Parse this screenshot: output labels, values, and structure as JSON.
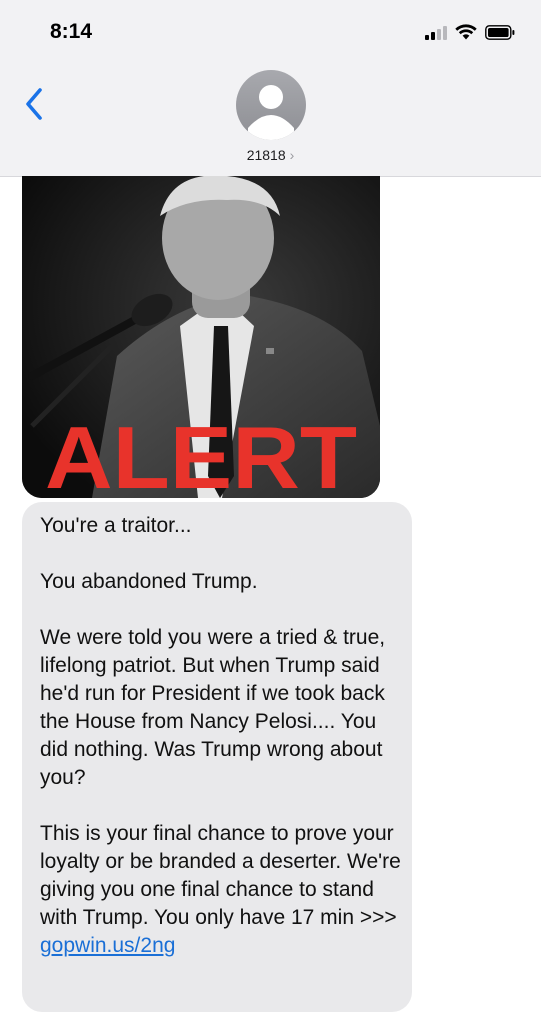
{
  "status_bar": {
    "time": "8:14"
  },
  "header": {
    "contact": "21818",
    "chevron": "›"
  },
  "message": {
    "image_text": "ALERT",
    "paragraphs": [
      "You're a traitor...",
      "You abandoned Trump.",
      "We were told you were a tried & true, lifelong patriot. But when Trump said he'd run for President if we took back the House from Nancy Pelosi.... You did nothing. Was Trump wrong about you?"
    ],
    "final_text": "This is your final chance to prove your loyalty or be branded a deserter. We're giving you one final chance to stand with Trump. You only have 17 min >>>",
    "link": "gopwin.us/2ng"
  },
  "colors": {
    "header_bg": "#f2f2f4",
    "bubble_bg": "#e9e9eb",
    "link": "#1a6fd6",
    "alert_red": "#e8332b",
    "back_blue": "#1a73e8"
  },
  "icons": [
    "back-chevron-icon",
    "avatar-person-icon",
    "signal-icon",
    "wifi-icon",
    "battery-icon"
  ]
}
